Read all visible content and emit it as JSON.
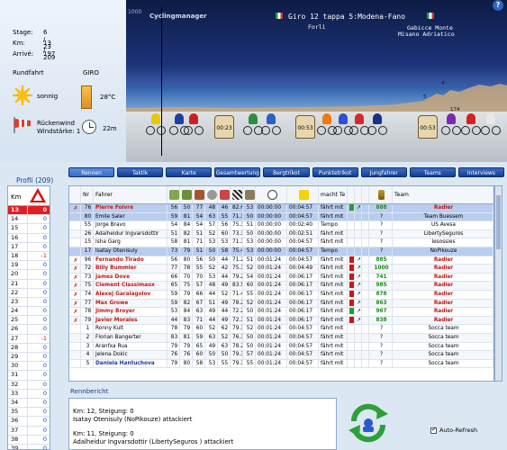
{
  "stage_info": {
    "stage_label": "Stage:",
    "stage_value": "6 / 23",
    "km_label": "Km:",
    "km_value": "13 / 209",
    "arrive_label": "Arrivé:",
    "arrive_value": "197"
  },
  "weather": {
    "rundfahrt_label": "Rundfahrt",
    "giro_label": "GIRO",
    "sky": "sonnig",
    "temperature": "28°C",
    "wind_line1": "Rückenwind",
    "wind_line2": "Windstärke: 1",
    "time": "22m"
  },
  "stage_graphic": {
    "title": "Giro 12 tappa 5:Modena-Fano",
    "logo": "Cyclingmanager",
    "y_top": "1000",
    "towns": {
      "forli": "Forlì",
      "sabicce": "Gabicce Monte",
      "misano": "Misano Adriatico"
    },
    "km_marks": [
      "-",
      "2",
      "4",
      "5",
      "174"
    ],
    "sacks": [
      "00:23",
      "00:53",
      "00:53"
    ]
  },
  "profile": {
    "title": "Profil (209)",
    "header_km": "Km",
    "rows": [
      {
        "km": "13",
        "v": "0",
        "sel": true
      },
      {
        "km": "14",
        "v": "0"
      },
      {
        "km": "15",
        "v": "0"
      },
      {
        "km": "16",
        "v": "0"
      },
      {
        "km": "17",
        "v": "0"
      },
      {
        "km": "18",
        "v": "-1"
      },
      {
        "km": "19",
        "v": "0"
      },
      {
        "km": "20",
        "v": "0"
      },
      {
        "km": "21",
        "v": "0"
      },
      {
        "km": "22",
        "v": "0"
      },
      {
        "km": "23",
        "v": "0"
      },
      {
        "km": "24",
        "v": "0"
      },
      {
        "km": "25",
        "v": "0"
      },
      {
        "km": "26",
        "v": "0"
      },
      {
        "km": "27",
        "v": "-1"
      },
      {
        "km": "28",
        "v": "0"
      },
      {
        "km": "29",
        "v": "0"
      },
      {
        "km": "30",
        "v": "0"
      },
      {
        "km": "31",
        "v": "0"
      },
      {
        "km": "32",
        "v": "0"
      },
      {
        "km": "33",
        "v": "0"
      },
      {
        "km": "34",
        "v": "0"
      },
      {
        "km": "35",
        "v": "0"
      },
      {
        "km": "36",
        "v": "0"
      },
      {
        "km": "37",
        "v": "0"
      },
      {
        "km": "38",
        "v": "0"
      },
      {
        "km": "39",
        "v": "0"
      }
    ]
  },
  "tabs": [
    "Rennen",
    "Taktik",
    "Karte",
    "Gesamtwertung",
    "Bergtrikot",
    "Punktetrikot",
    "Jungfahrer",
    "Teams",
    "Interviews"
  ],
  "table": {
    "headers": {
      "nr": "Nr",
      "fahrer": "Fahrer",
      "macht": "macht Te",
      "team": "Team"
    },
    "rows": [
      {
        "x": "✗",
        "nr": "76",
        "name": "Pierre Foivre",
        "red": true,
        "s": [
          "56",
          "50",
          "77",
          "48",
          "46",
          "82.6",
          "53"
        ],
        "t1": "00:00:00",
        "t2": "00:04:57",
        "mt": "fährt mit",
        "box": "green",
        "e": "888",
        "team": "Radler",
        "radler": true,
        "sel": true
      },
      {
        "x": "",
        "nr": "80",
        "name": "Emile Saler",
        "s": [
          "59",
          "81",
          "54",
          "63",
          "55",
          "71.3",
          "50"
        ],
        "t1": "00:00:00",
        "t2": "00:04:57",
        "mt": "fährt mit",
        "box": "",
        "e": "?",
        "team": "Team Buessem",
        "sel": true
      },
      {
        "x": "",
        "nr": "55",
        "name": "Jorge Bravo",
        "s": [
          "54",
          "84",
          "54",
          "57",
          "56",
          "75.3",
          "51"
        ],
        "t1": "00:00:00",
        "t2": "00:02:40",
        "mt": "Tempo",
        "box": "",
        "e": "?",
        "team": "US Avesa"
      },
      {
        "x": "",
        "nr": "26",
        "name": "Adalheidur Ingvarsdottir",
        "s": [
          "51",
          "82",
          "51",
          "52",
          "60",
          "73.3",
          "50"
        ],
        "t1": "00:00:00",
        "t2": "00:02:51",
        "mt": "fährt mit",
        "box": "",
        "e": "?",
        "team": "LibertySeguros"
      },
      {
        "x": "",
        "nr": "15",
        "name": "Isha Garg",
        "s": [
          "58",
          "81",
          "71",
          "53",
          "53",
          "71.3",
          "53"
        ],
        "t1": "00:00:00",
        "t2": "00:04:57",
        "mt": "fährt mit",
        "box": "",
        "e": "?",
        "team": "lesossies"
      },
      {
        "x": "",
        "nr": "17",
        "name": "Isatay Otenisuly",
        "s": [
          "73",
          "79",
          "51",
          "50",
          "58",
          "75.4",
          "53"
        ],
        "t1": "00:00:00",
        "t2": "00:04:57",
        "mt": "Tempo",
        "box": "",
        "e": "?",
        "team": "NoPikouze",
        "sel": true
      },
      {
        "x": "✗",
        "nr": "96",
        "name": "Fernando Tirado",
        "red": true,
        "s": [
          "56",
          "80",
          "56",
          "50",
          "44",
          "71.2",
          "51"
        ],
        "t1": "00:01:24",
        "t2": "00:04:57",
        "mt": "fährt mit",
        "box": "red",
        "e": "885",
        "team": "Radler",
        "radler": true
      },
      {
        "x": "✗",
        "nr": "72",
        "name": "Billy Bummler",
        "red": true,
        "s": [
          "77",
          "78",
          "55",
          "52",
          "42",
          "75.3",
          "52"
        ],
        "t1": "00:01:24",
        "t2": "00:04:49",
        "mt": "fährt mit",
        "box": "red",
        "e": "1000",
        "team": "Radler",
        "radler": true
      },
      {
        "x": "✗",
        "nr": "73",
        "name": "James Dove",
        "red": true,
        "s": [
          "66",
          "70",
          "70",
          "53",
          "44",
          "79.2",
          "54"
        ],
        "t1": "00:01:24",
        "t2": "00:06:17",
        "mt": "fährt mit",
        "box": "red",
        "e": "741",
        "team": "Radler",
        "radler": true
      },
      {
        "x": "✗",
        "nr": "75",
        "name": "Clement Classimaux",
        "red": true,
        "s": [
          "65",
          "75",
          "57",
          "48",
          "49",
          "83.5",
          "60"
        ],
        "t1": "00:01:24",
        "t2": "00:06:17",
        "mt": "fährt mit",
        "box": "red",
        "e": "985",
        "team": "Radler",
        "radler": true
      },
      {
        "x": "✗",
        "nr": "74",
        "name": "Alexej Garalagolov",
        "red": true,
        "s": [
          "59",
          "79",
          "66",
          "44",
          "52",
          "71.4",
          "55"
        ],
        "t1": "00:01:24",
        "t2": "00:06:17",
        "mt": "fährt mit",
        "box": "red",
        "e": "878",
        "team": "Radler",
        "radler": true
      },
      {
        "x": "✗",
        "nr": "77",
        "name": "Max Growe",
        "red": true,
        "s": [
          "59",
          "82",
          "67",
          "51",
          "49",
          "78.2",
          "52"
        ],
        "t1": "00:01:24",
        "t2": "00:06:17",
        "mt": "fährt mit",
        "box": "red",
        "e": "863",
        "team": "Radler",
        "radler": true
      },
      {
        "x": "✗",
        "nr": "78",
        "name": "Jimmy Broyer",
        "red": true,
        "s": [
          "53",
          "84",
          "63",
          "49",
          "44",
          "72.2",
          "50"
        ],
        "t1": "00:01:24",
        "t2": "00:06:17",
        "mt": "fährt mit",
        "box": "green",
        "e": "967",
        "team": "Radler",
        "radler": true
      },
      {
        "x": "✗",
        "nr": "79",
        "name": "Javier Morales",
        "red": true,
        "s": [
          "44",
          "83",
          "71",
          "44",
          "49",
          "72.3",
          "51"
        ],
        "t1": "00:01:24",
        "t2": "00:06:17",
        "mt": "fährt mit",
        "box": "red",
        "e": "838",
        "team": "Radler",
        "radler": true
      },
      {
        "x": "",
        "nr": "1",
        "name": "Ronny Kult",
        "s": [
          "78",
          "79",
          "60",
          "52",
          "62",
          "79.3",
          "52"
        ],
        "t1": "00:01:24",
        "t2": "00:04:57",
        "mt": "fährt mit",
        "box": "",
        "e": "?",
        "team": "Socca team"
      },
      {
        "x": "",
        "nr": "2",
        "name": "Florian Bangerter",
        "s": [
          "83",
          "81",
          "59",
          "63",
          "52",
          "76.3",
          "50"
        ],
        "t1": "00:01:24",
        "t2": "00:04:57",
        "mt": "fährt mit",
        "box": "",
        "e": "?",
        "team": "Socca team"
      },
      {
        "x": "",
        "nr": "3",
        "name": "Aranfxa Rua",
        "s": [
          "79",
          "79",
          "65",
          "49",
          "63",
          "78.2",
          "50"
        ],
        "t1": "00:01:24",
        "t2": "00:04:57",
        "mt": "fährt mit",
        "box": "",
        "e": "?",
        "team": "Socca team"
      },
      {
        "x": "",
        "nr": "4",
        "name": "Jelena Dokic",
        "s": [
          "76",
          "76",
          "60",
          "50",
          "50",
          "79.3",
          "57"
        ],
        "t1": "00:01:24",
        "t2": "00:04:57",
        "mt": "fährt mit",
        "box": "",
        "e": "?",
        "team": "Socca team"
      },
      {
        "x": "",
        "nr": "5",
        "name": "Daniela Hantuchova",
        "blue": true,
        "s": [
          "79",
          "80",
          "58",
          "53",
          "55",
          "79.3",
          "55"
        ],
        "t1": "00:01:24",
        "t2": "00:04:57",
        "mt": "fährt mit",
        "box": "",
        "e": "?",
        "team": "Socca team"
      }
    ]
  },
  "report": {
    "title": "Rennbericht",
    "lines": [
      "Km: 12, Steigung: 0",
      "Isatay Otenisuly (NoPikouze) attackiert",
      "Km: 11, Steigung: 0",
      "Adalheidur Ingvarsdottir (LibertySeguros ) attackiert"
    ]
  },
  "auto_refresh": {
    "label": "Auto-Refresh",
    "checked": true
  },
  "colors": {
    "accent": "#1c3d8f",
    "red": "#c01818",
    "tab": "#2a5cb8"
  }
}
